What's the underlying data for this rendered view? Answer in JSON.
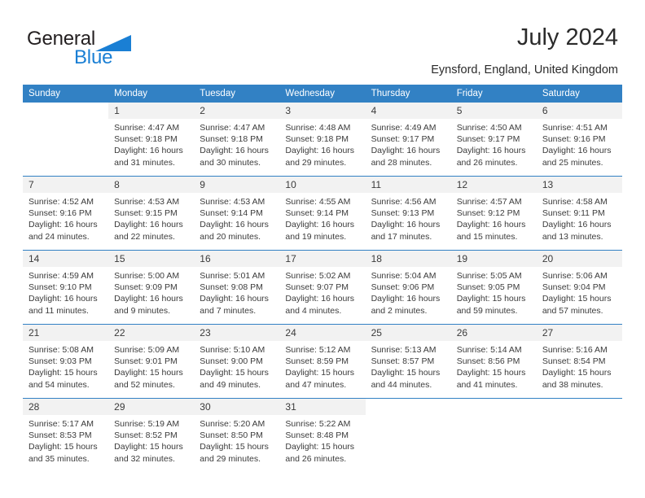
{
  "brand": {
    "name_primary": "General",
    "name_secondary": "Blue",
    "triangle_color": "#1a7fd4",
    "primary_color": "#231f20"
  },
  "header": {
    "title": "July 2024",
    "subtitle": "Eynsford, England, United Kingdom"
  },
  "theme": {
    "header_bg": "#3281c4",
    "daynum_bg": "#f2f2f2",
    "divider": "#3281c4",
    "text": "#3b3b3b"
  },
  "calendar": {
    "weekday_headers": [
      "Sunday",
      "Monday",
      "Tuesday",
      "Wednesday",
      "Thursday",
      "Friday",
      "Saturday"
    ],
    "labels": {
      "sunrise": "Sunrise:",
      "sunset": "Sunset:",
      "daylight": "Daylight:"
    },
    "weeks": [
      [
        {
          "day": "",
          "lines": []
        },
        {
          "day": "1",
          "lines": [
            "Sunrise: 4:47 AM",
            "Sunset: 9:18 PM",
            "Daylight: 16 hours",
            "and 31 minutes."
          ]
        },
        {
          "day": "2",
          "lines": [
            "Sunrise: 4:47 AM",
            "Sunset: 9:18 PM",
            "Daylight: 16 hours",
            "and 30 minutes."
          ]
        },
        {
          "day": "3",
          "lines": [
            "Sunrise: 4:48 AM",
            "Sunset: 9:18 PM",
            "Daylight: 16 hours",
            "and 29 minutes."
          ]
        },
        {
          "day": "4",
          "lines": [
            "Sunrise: 4:49 AM",
            "Sunset: 9:17 PM",
            "Daylight: 16 hours",
            "and 28 minutes."
          ]
        },
        {
          "day": "5",
          "lines": [
            "Sunrise: 4:50 AM",
            "Sunset: 9:17 PM",
            "Daylight: 16 hours",
            "and 26 minutes."
          ]
        },
        {
          "day": "6",
          "lines": [
            "Sunrise: 4:51 AM",
            "Sunset: 9:16 PM",
            "Daylight: 16 hours",
            "and 25 minutes."
          ]
        }
      ],
      [
        {
          "day": "7",
          "lines": [
            "Sunrise: 4:52 AM",
            "Sunset: 9:16 PM",
            "Daylight: 16 hours",
            "and 24 minutes."
          ]
        },
        {
          "day": "8",
          "lines": [
            "Sunrise: 4:53 AM",
            "Sunset: 9:15 PM",
            "Daylight: 16 hours",
            "and 22 minutes."
          ]
        },
        {
          "day": "9",
          "lines": [
            "Sunrise: 4:53 AM",
            "Sunset: 9:14 PM",
            "Daylight: 16 hours",
            "and 20 minutes."
          ]
        },
        {
          "day": "10",
          "lines": [
            "Sunrise: 4:55 AM",
            "Sunset: 9:14 PM",
            "Daylight: 16 hours",
            "and 19 minutes."
          ]
        },
        {
          "day": "11",
          "lines": [
            "Sunrise: 4:56 AM",
            "Sunset: 9:13 PM",
            "Daylight: 16 hours",
            "and 17 minutes."
          ]
        },
        {
          "day": "12",
          "lines": [
            "Sunrise: 4:57 AM",
            "Sunset: 9:12 PM",
            "Daylight: 16 hours",
            "and 15 minutes."
          ]
        },
        {
          "day": "13",
          "lines": [
            "Sunrise: 4:58 AM",
            "Sunset: 9:11 PM",
            "Daylight: 16 hours",
            "and 13 minutes."
          ]
        }
      ],
      [
        {
          "day": "14",
          "lines": [
            "Sunrise: 4:59 AM",
            "Sunset: 9:10 PM",
            "Daylight: 16 hours",
            "and 11 minutes."
          ]
        },
        {
          "day": "15",
          "lines": [
            "Sunrise: 5:00 AM",
            "Sunset: 9:09 PM",
            "Daylight: 16 hours",
            "and 9 minutes."
          ]
        },
        {
          "day": "16",
          "lines": [
            "Sunrise: 5:01 AM",
            "Sunset: 9:08 PM",
            "Daylight: 16 hours",
            "and 7 minutes."
          ]
        },
        {
          "day": "17",
          "lines": [
            "Sunrise: 5:02 AM",
            "Sunset: 9:07 PM",
            "Daylight: 16 hours",
            "and 4 minutes."
          ]
        },
        {
          "day": "18",
          "lines": [
            "Sunrise: 5:04 AM",
            "Sunset: 9:06 PM",
            "Daylight: 16 hours",
            "and 2 minutes."
          ]
        },
        {
          "day": "19",
          "lines": [
            "Sunrise: 5:05 AM",
            "Sunset: 9:05 PM",
            "Daylight: 15 hours",
            "and 59 minutes."
          ]
        },
        {
          "day": "20",
          "lines": [
            "Sunrise: 5:06 AM",
            "Sunset: 9:04 PM",
            "Daylight: 15 hours",
            "and 57 minutes."
          ]
        }
      ],
      [
        {
          "day": "21",
          "lines": [
            "Sunrise: 5:08 AM",
            "Sunset: 9:03 PM",
            "Daylight: 15 hours",
            "and 54 minutes."
          ]
        },
        {
          "day": "22",
          "lines": [
            "Sunrise: 5:09 AM",
            "Sunset: 9:01 PM",
            "Daylight: 15 hours",
            "and 52 minutes."
          ]
        },
        {
          "day": "23",
          "lines": [
            "Sunrise: 5:10 AM",
            "Sunset: 9:00 PM",
            "Daylight: 15 hours",
            "and 49 minutes."
          ]
        },
        {
          "day": "24",
          "lines": [
            "Sunrise: 5:12 AM",
            "Sunset: 8:59 PM",
            "Daylight: 15 hours",
            "and 47 minutes."
          ]
        },
        {
          "day": "25",
          "lines": [
            "Sunrise: 5:13 AM",
            "Sunset: 8:57 PM",
            "Daylight: 15 hours",
            "and 44 minutes."
          ]
        },
        {
          "day": "26",
          "lines": [
            "Sunrise: 5:14 AM",
            "Sunset: 8:56 PM",
            "Daylight: 15 hours",
            "and 41 minutes."
          ]
        },
        {
          "day": "27",
          "lines": [
            "Sunrise: 5:16 AM",
            "Sunset: 8:54 PM",
            "Daylight: 15 hours",
            "and 38 minutes."
          ]
        }
      ],
      [
        {
          "day": "28",
          "lines": [
            "Sunrise: 5:17 AM",
            "Sunset: 8:53 PM",
            "Daylight: 15 hours",
            "and 35 minutes."
          ]
        },
        {
          "day": "29",
          "lines": [
            "Sunrise: 5:19 AM",
            "Sunset: 8:52 PM",
            "Daylight: 15 hours",
            "and 32 minutes."
          ]
        },
        {
          "day": "30",
          "lines": [
            "Sunrise: 5:20 AM",
            "Sunset: 8:50 PM",
            "Daylight: 15 hours",
            "and 29 minutes."
          ]
        },
        {
          "day": "31",
          "lines": [
            "Sunrise: 5:22 AM",
            "Sunset: 8:48 PM",
            "Daylight: 15 hours",
            "and 26 minutes."
          ]
        },
        {
          "day": "",
          "lines": []
        },
        {
          "day": "",
          "lines": []
        },
        {
          "day": "",
          "lines": []
        }
      ]
    ]
  }
}
